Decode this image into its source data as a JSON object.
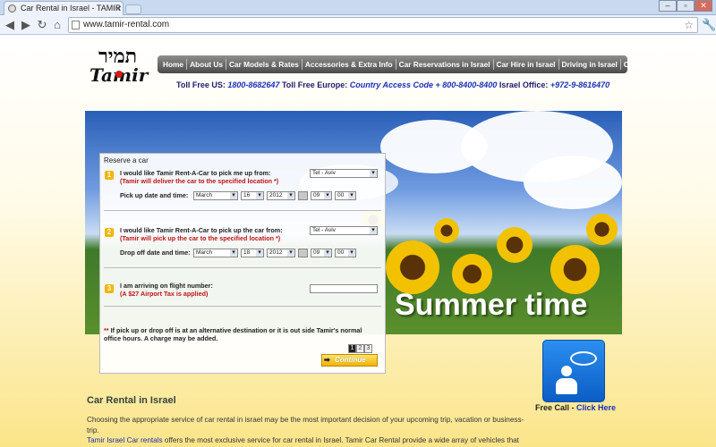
{
  "browser": {
    "tab_title": "Car Rental in Israel - TAMIR R",
    "tab_close": "x",
    "url": "www.tamir-rental.com",
    "window_controls": [
      "–",
      "▫",
      "✕"
    ]
  },
  "logo": {
    "hebrew": "תמיר",
    "latin": "Tamir"
  },
  "nav": [
    "Home",
    "About Us",
    "Car Models & Rates",
    "Accessories & Extra Info",
    "Car Reservations in Israel",
    "Car Hire in Israel",
    "Driving in Israel",
    "Contact Us"
  ],
  "contact": {
    "us_label": "Toll Free US:",
    "us_num": "1800-8682647",
    "eu_label": "Toll Free Europe:",
    "eu_num": "Country Access Code + 800-8400-8400",
    "il_label": "Israel Office:",
    "il_num": "+972-9-8616470"
  },
  "banner": {
    "text": "Summer time"
  },
  "form": {
    "title": "Reserve a car",
    "step1": {
      "num": "1",
      "line1": "I would like Tamir Rent-A-Car to pick me up from:",
      "line2": "(Tamir will deliver the car to the specified location *)",
      "location": "Tel - Aviv",
      "date_label": "Pick up date and time:",
      "month": "March",
      "day": "16",
      "year": "2012",
      "hour": "09",
      "minute": "00"
    },
    "step2": {
      "num": "2",
      "line1": "I would like Tamir Rent-A-Car to pick up the car from:",
      "line2": "(Tamir will pick up the car to the specified location *)",
      "location": "Tel - Aviv",
      "date_label": "Drop off date and time:",
      "month": "March",
      "day": "18",
      "year": "2012",
      "hour": "09",
      "minute": "00"
    },
    "step3": {
      "num": "3",
      "line1": "I am arriving on flight number:",
      "line2": "(A $27 Airport Tax is applied)"
    },
    "note_ast": "**",
    "note": " If pick up or drop off is at an alternative destination or it is out side Tamir's normal office hours. A charge may be added.",
    "pages": [
      "1",
      "2",
      "3"
    ],
    "continue": "Continue"
  },
  "freecall": {
    "label": "Free Call",
    "link": "Click Here"
  },
  "article": {
    "heading": "Car Rental in Israel",
    "p1": "Choosing the appropriate service of car rental in israel may be the most important decision of your upcoming trip, vacation or business-trip.",
    "p2_link": "Tamir Israel Car rentals",
    "p2": " offers the most exclusive service for car rental in Israel. Tamir Car Rental provide a wide array of vehicles that are made especially for your needs, from compact car to family car and vans. Tamir Car Rental in Israel make driving a memorable experience."
  },
  "colors": {
    "accent_blue": "#1a2fb8",
    "warning_red": "#c01515",
    "step_yellow": "#f5b400"
  }
}
